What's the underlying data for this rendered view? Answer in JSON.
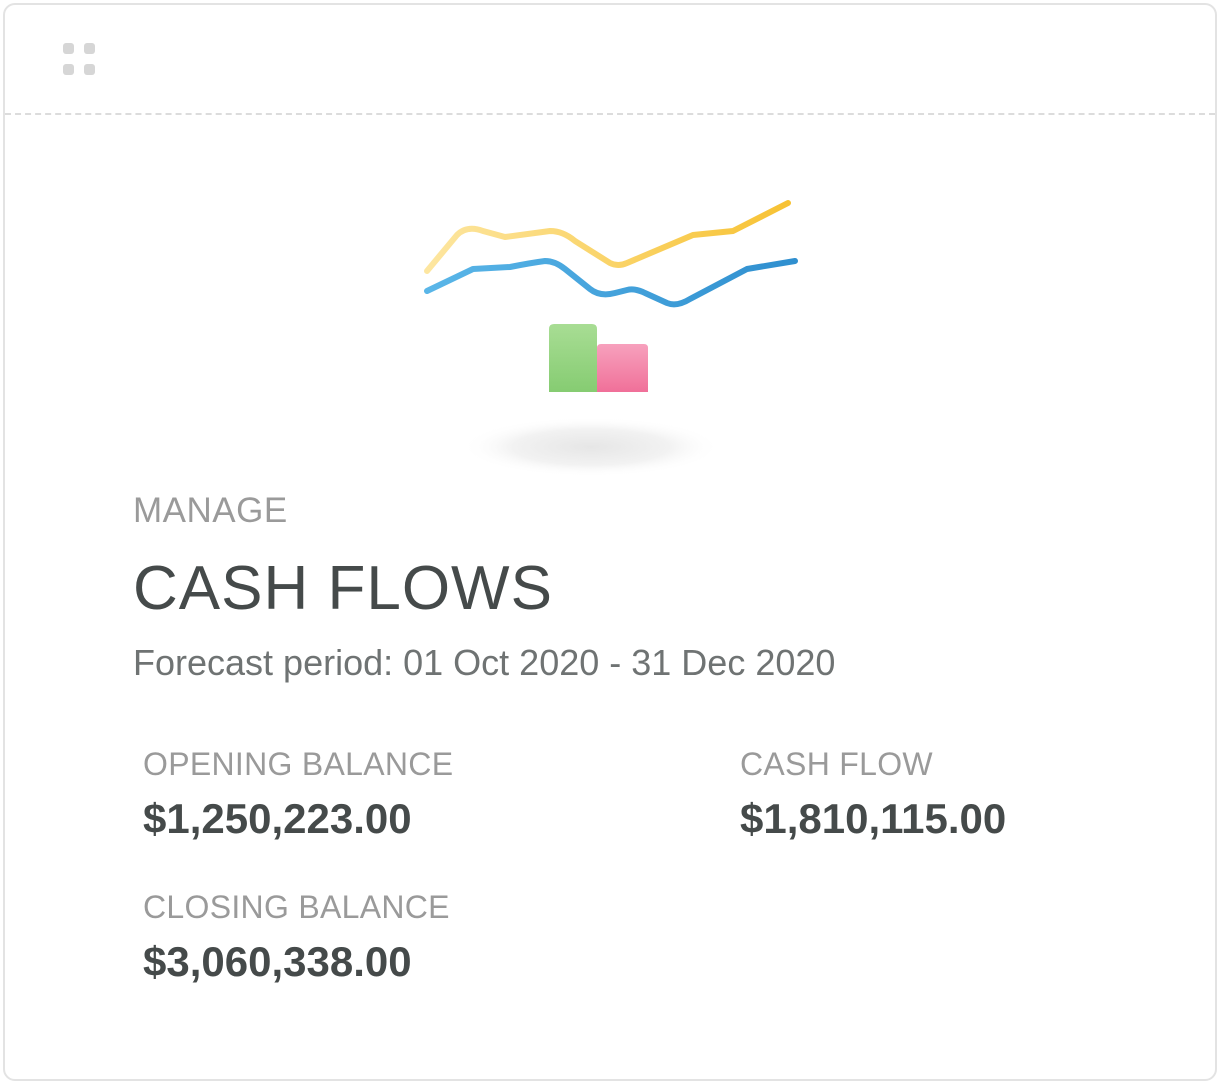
{
  "card": {
    "eyebrow": "MANAGE",
    "title": "CASH FLOWS",
    "forecast_period": "Forecast period: 01 Oct 2020 - 31 Dec 2020"
  },
  "stats": {
    "opening_balance": {
      "label": "OPENING BALANCE",
      "value": "$1,250,223.00"
    },
    "cash_flow": {
      "label": "CASH FLOW",
      "value": "$1,810,115.00"
    },
    "closing_balance": {
      "label": "CLOSING BALANCE",
      "value": "$3,060,338.00"
    }
  },
  "illustration": {
    "icon": "cash-flow-chart-icon",
    "colors": {
      "line_upper": "#f7c233",
      "line_lower": "#3b9ed8",
      "bar_green": "#8fd17c",
      "bar_pink": "#f27aa0"
    }
  }
}
